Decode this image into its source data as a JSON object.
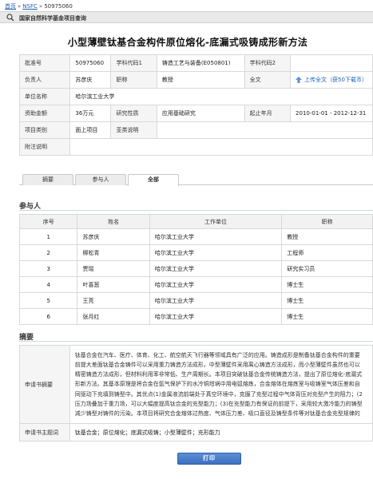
{
  "breadcrumb": {
    "home": "首页",
    "nsfc": "NSFC",
    "current": "50975060"
  },
  "searchbar": {
    "label": "国家自然科学基金项目查询"
  },
  "title": "小型薄壁钛基合金构件原位熔化-底漏式吸铸成形新方法",
  "info": {
    "approval_no_label": "批准号",
    "approval_no": "50975060",
    "code1_label": "学科代码1",
    "code1": "铸造工艺与装备(E050801)",
    "code2_label": "学科代码2",
    "code2": "",
    "leader_label": "负责人",
    "leader": "苏彦庆",
    "title_label": "职称",
    "title_value": "教授",
    "fulltext_label": "全文",
    "fulltext_link": "上传全文（获50下载币）",
    "unit_label": "单位名称",
    "unit": "哈尔滨工业大学",
    "funding_label": "资助金额",
    "funding": "36万元",
    "nature_label": "研究性质",
    "nature": "应用基础研究",
    "period_label": "起止年月",
    "period": "2010-01-01 - 2012-12-31",
    "category_label": "项目类别",
    "category": "面上项目",
    "subcategory_label": "亚类说明",
    "subcategory": "",
    "note_label": "附注说明",
    "note": ""
  },
  "tabs": [
    "摘要",
    "参与人",
    "全部"
  ],
  "participants": {
    "heading": "参与人",
    "columns": [
      "序号",
      "姓名",
      "工作单位",
      "职称"
    ],
    "rows": [
      [
        "1",
        "苏彦庆",
        "哈尔滨工业大学",
        "教授"
      ],
      [
        "2",
        "柳松青",
        "哈尔滨工业大学",
        "工程师"
      ],
      [
        "3",
        "贾瑶",
        "哈尔滨工业大学",
        "研究实习员"
      ],
      [
        "4",
        "叶喜葱",
        "哈尔滨工业大学",
        "博士生"
      ],
      [
        "5",
        "王亮",
        "哈尔滨工业大学",
        "博士生"
      ],
      [
        "6",
        "张月红",
        "哈尔滨工业大学",
        "博士生"
      ]
    ]
  },
  "abstract": {
    "heading": "摘要",
    "summary_label": "申请书摘要",
    "summary_lines": [
      "钛基合金在汽车、医疗、体育、化工、航空航天飞行器等领域具有广泛的应用。铸造成形是制备钛基合金构件的重要",
      "前提大差面钛基合金铸件可以采用重力铸造方法成形，中型薄壁件采用离心铸造方法成形，而小型薄壁件虽然也可以",
      "精密铸造方法成形，但材料利用率非常低、生产周期长。本项目突破钛基合金传统铸造方法，提出了原位熔化-底漏式",
      "形新方法。其基本原理是将合金在氩气保护下的水冷铜坩埚中用电弧熔炼，合金熔体在熔炼室与吸铸室气体压差和自",
      "同驱动下充填到铸型中。其优点(1)金属液流前端处于真空环境中，克服了充型过程中气体背压对充型产生的阻力；(2",
      "压力场叠加于重力场，可以大幅度提高钛合金的充型能力；(3)在充型能力有保证的前提下，采用较大激冷能力的铸型",
      "减少铸型对铸件的污染。本项目将研究合金熔体过热度、气体压力差、吸口直径及铸型条件等对钛基合金充型规律的"
    ],
    "keywords_label": "申请书主题词",
    "keywords": "钛基合金；原位熔化；底漏式吸铸；小型薄壁件；充形能力"
  },
  "print_label": "打印",
  "colors": {
    "link": "#1a5fb4",
    "accent": "#3d6fbf",
    "header_bg": "#f5f5f5"
  }
}
